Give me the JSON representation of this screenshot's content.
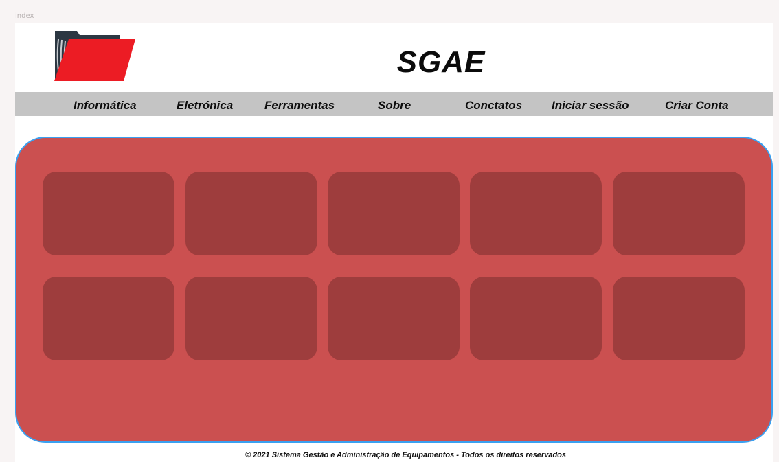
{
  "frame": {
    "label": "index"
  },
  "header": {
    "title": "SGAE",
    "logo_icon": "folder-icon"
  },
  "nav": {
    "items": [
      {
        "label": "Informática"
      },
      {
        "label": "Eletrónica"
      },
      {
        "label": "Ferramentas"
      },
      {
        "label": "Sobre"
      },
      {
        "label": "Conctatos"
      },
      {
        "label": "Iniciar sessão"
      },
      {
        "label": "Criar Conta"
      }
    ]
  },
  "colors": {
    "nav_bg": "#c4c4c4",
    "panel_bg": "#cb5050",
    "panel_border": "#3aa0f0",
    "card_bg": "#9e3d3d",
    "logo_red": "#ec1c24",
    "logo_dark": "#2c3742"
  },
  "footer": {
    "text": "© 2021 Sistema Gestão e Administração de Equipamentos - Todos os direitos reservados"
  }
}
